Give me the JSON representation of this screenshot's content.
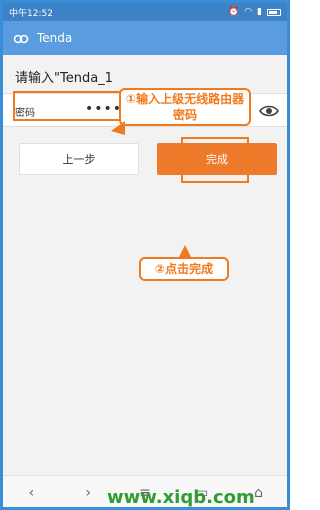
{
  "status": {
    "time": "中午12:52"
  },
  "appbar": {
    "title": "Tenda",
    "logo_icon": "tenda-logo-icon"
  },
  "main": {
    "prompt": "请输入\"Tenda_1",
    "password_label": "密码",
    "password_value": "••••••••••",
    "prev_button": "上一步",
    "done_button": "完成"
  },
  "annotations": {
    "callout_1": "①输入上级无线路由器密码",
    "callout_2": "②点击完成",
    "accent_color": "#f07a1e"
  },
  "watermark": "www.xiqb.com",
  "colors": {
    "statusbar": "#3c82c6",
    "appbar": "#5b9be0",
    "done_button": "#ee7a2b"
  }
}
